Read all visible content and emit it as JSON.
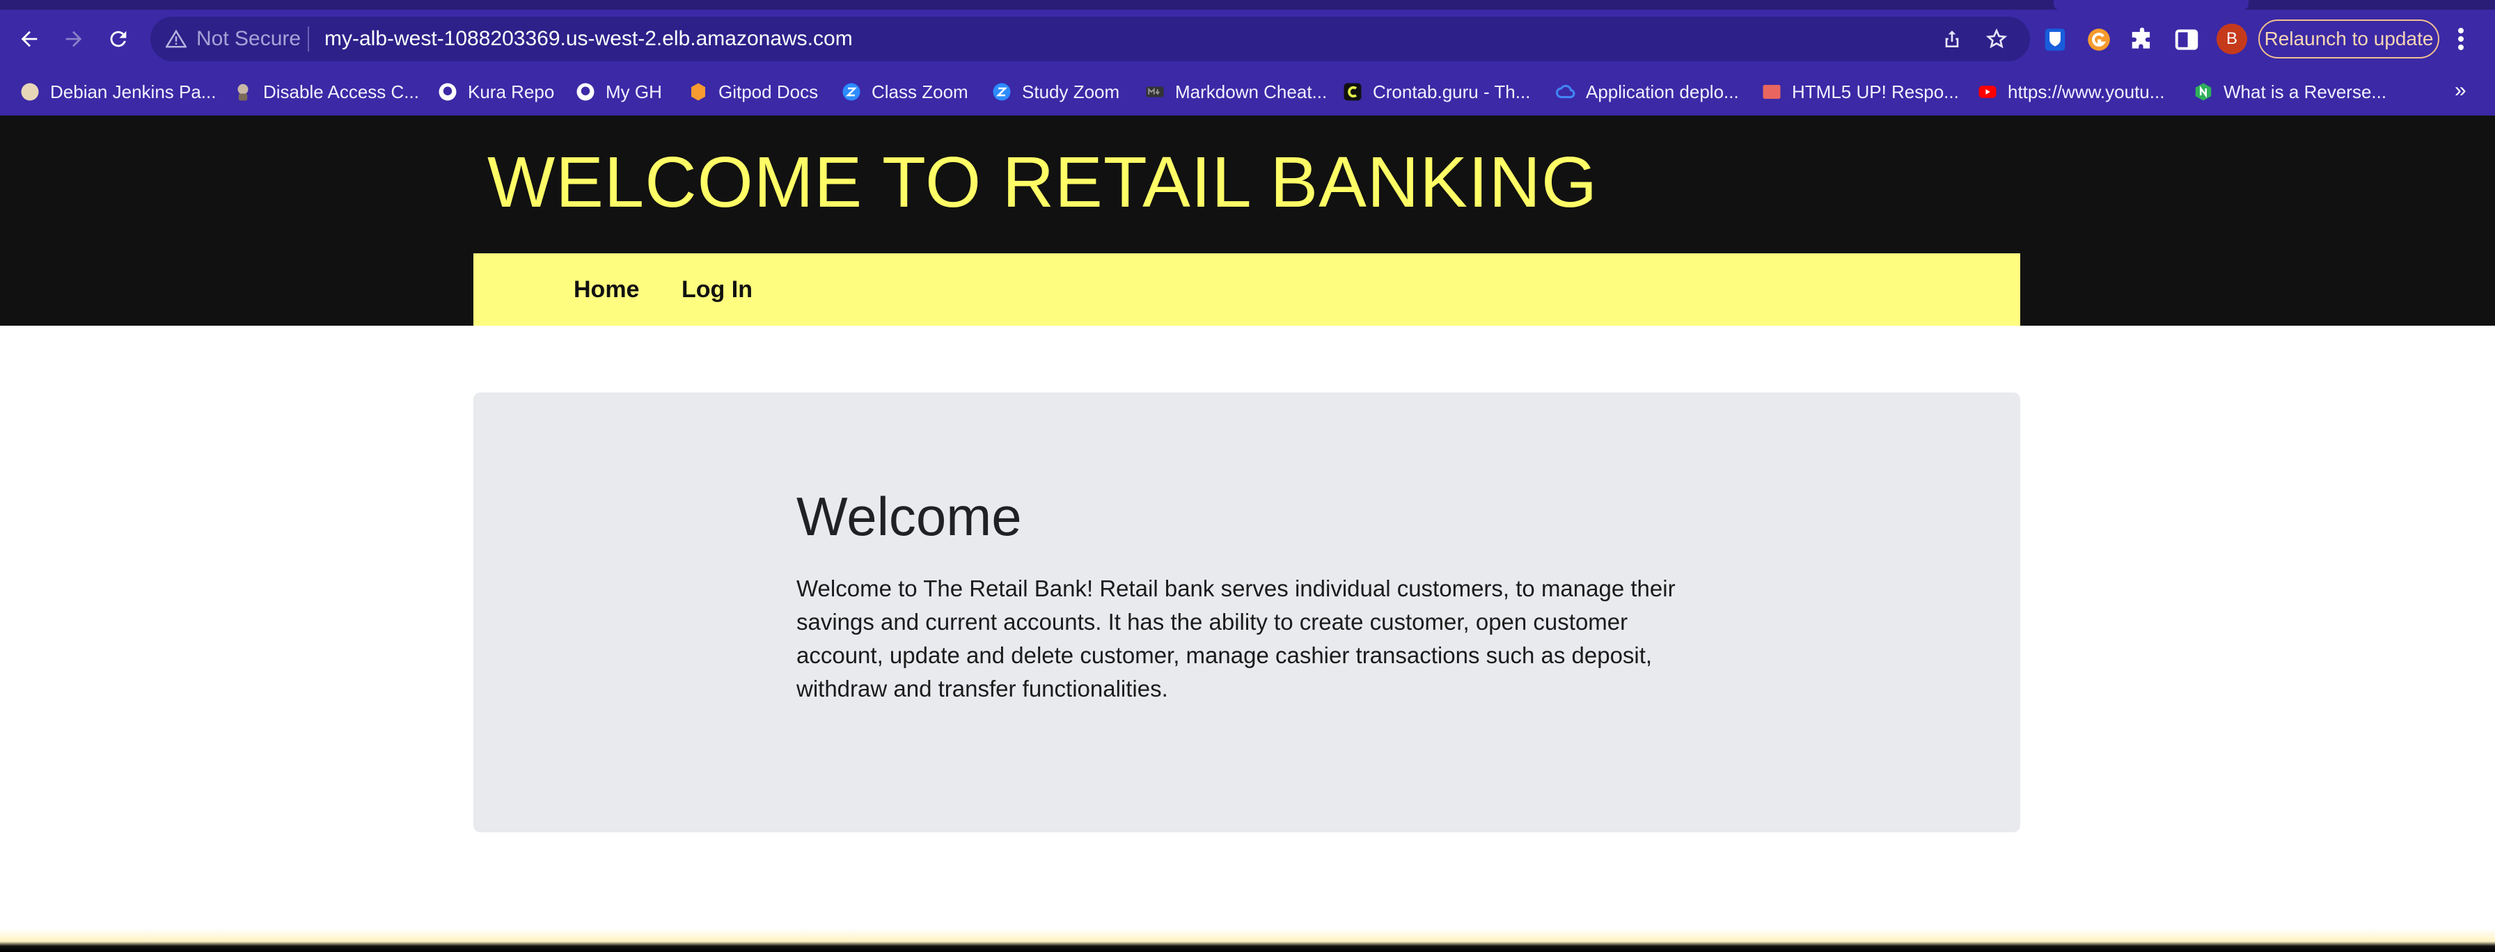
{
  "browser": {
    "security_label": "Not Secure",
    "url": "my-alb-west-1088203369.us-west-2.elb.amazonaws.com",
    "relaunch_label": "Relaunch to update",
    "avatar_letter": "B",
    "icons": [
      "back-arrow-icon",
      "forward-arrow-icon",
      "reload-icon",
      "warning-icon",
      "share-icon",
      "bookmark-star-icon",
      "bitwarden-icon",
      "grammarly-icon",
      "extensions-puzzle-icon",
      "side-panel-icon",
      "kebab-menu-icon"
    ]
  },
  "bookmarks": [
    {
      "label": "Debian Jenkins Pa...",
      "icon": "debian-icon",
      "color": "#e8d6b8"
    },
    {
      "label": "Disable Access C...",
      "icon": "jenkins-icon",
      "color": "#c9b8a6"
    },
    {
      "label": "Kura Repo",
      "icon": "github-icon",
      "color": "#ffffff"
    },
    {
      "label": "My GH",
      "icon": "github-icon",
      "color": "#ffffff"
    },
    {
      "label": "Gitpod Docs",
      "icon": "gitpod-icon",
      "color": "#f89b31"
    },
    {
      "label": "Class Zoom",
      "icon": "zoom-icon",
      "color": "#2d8cff"
    },
    {
      "label": "Study Zoom",
      "icon": "zoom-icon",
      "color": "#2d8cff"
    },
    {
      "label": "Markdown Cheat...",
      "icon": "markdown-icon",
      "color": "#333333"
    },
    {
      "label": "Crontab.guru - Th...",
      "icon": "crontab-icon",
      "color": "#e3f04a"
    },
    {
      "label": "Application deplo...",
      "icon": "google-cloud-icon",
      "color": "#4285f4"
    },
    {
      "label": "HTML5 UP! Respo...",
      "icon": "html5up-icon",
      "color": "#e8665f"
    },
    {
      "label": "https://www.youtu...",
      "icon": "youtube-icon",
      "color": "#ff0000"
    },
    {
      "label": "What is a Reverse...",
      "icon": "nginx-icon",
      "color": "#2fb05b"
    }
  ],
  "bookmarks_overflow": "»",
  "site": {
    "title": "WELCOME TO RETAIL BANKING",
    "nav": [
      "Home",
      "Log In"
    ],
    "hero_heading": "Welcome",
    "hero_text": "Welcome to The Retail Bank! Retail bank serves individual customers, to manage their savings and current accounts. It has the ability to create customer, open customer account, update and delete customer, manage cashier transactions such as deposit, withdraw and transfer functionalities."
  },
  "colors": {
    "chrome": "#3b29a6",
    "header_bg": "#111111",
    "accent_yellow": "#fffd66",
    "nav_bg": "#fffd80",
    "hero_bg": "#e9eaee"
  }
}
